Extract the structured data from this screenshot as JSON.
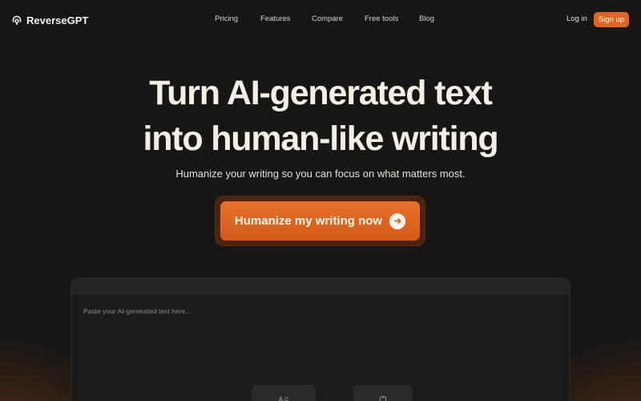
{
  "brand": {
    "name": "ReverseGPT",
    "logo_icon": "headset-logo-icon"
  },
  "nav": {
    "items": [
      "Pricing",
      "Features",
      "Compare",
      "Free tools",
      "Blog"
    ],
    "login_label": "Log in",
    "signup_label": "Sign up"
  },
  "hero": {
    "title_line1": "Turn AI-generated text",
    "title_line2": "into human-like writing",
    "subtitle": "Humanize your writing so you can focus on what matters most.",
    "cta_label": "Humanize my writing now",
    "cta_icon": "arrow-right-icon"
  },
  "editor": {
    "placeholder": "Paste your AI-generated text here...",
    "tools": [
      "text-format-icon",
      "clipboard-icon"
    ]
  },
  "colors": {
    "background": "#171615",
    "accent": "#e0651e",
    "text": "#f3efe4"
  }
}
